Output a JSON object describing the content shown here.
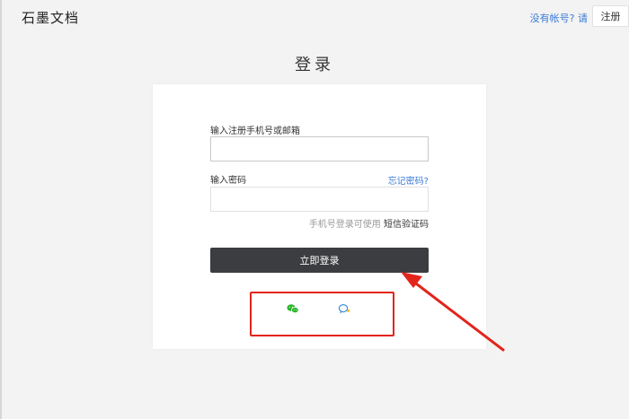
{
  "header": {
    "logo": "石墨文档",
    "signup_prompt": "没有帐号? 请",
    "signup_button": "注册"
  },
  "page": {
    "title": "登录"
  },
  "form": {
    "account_label": "输入注册手机号或邮箱",
    "account_value": "",
    "password_label": "输入密码",
    "password_value": "",
    "forgot_link": "忘记密码?",
    "hint_text": "手机号登录可使用",
    "sms_link": "短信验证码",
    "submit_button": "立即登录"
  },
  "social": {
    "icons": [
      "wechat-icon",
      "qq-icon"
    ]
  },
  "colors": {
    "accent_link": "#3c7bd6",
    "primary_button": "#3b3d40",
    "annotation": "#e3241b",
    "wechat": "#2bb62b",
    "qq": "#3a8fe0"
  }
}
